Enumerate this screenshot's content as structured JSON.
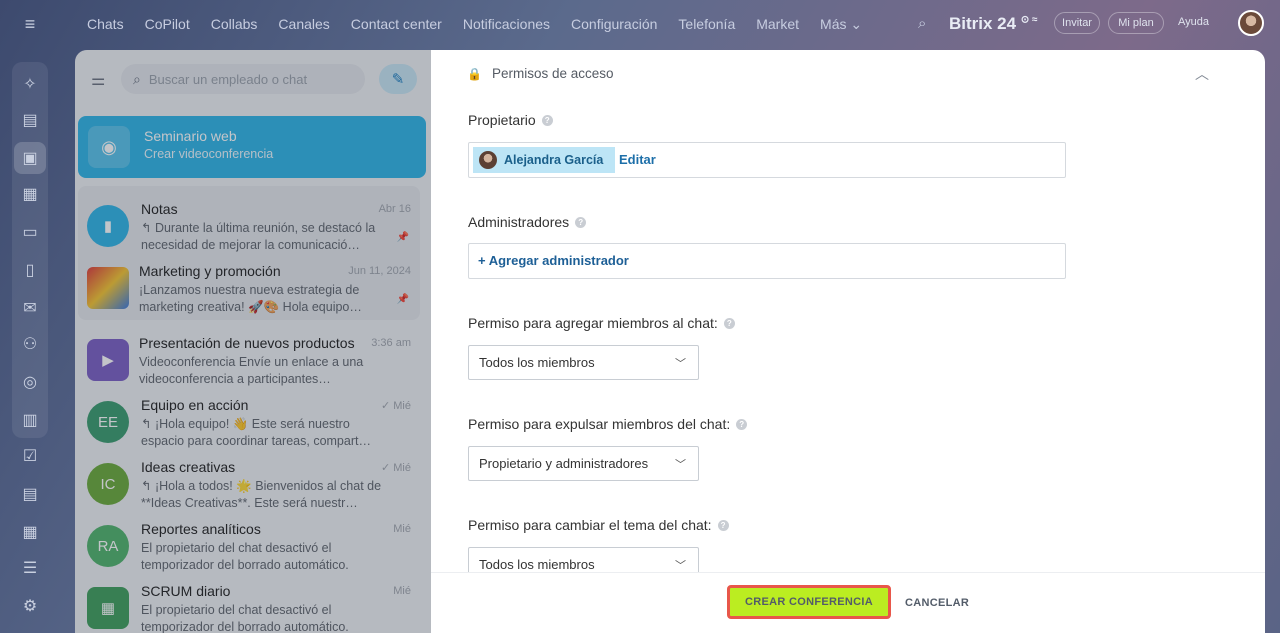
{
  "topnav": [
    "Chats",
    "CoPilot",
    "Collabs",
    "Canales",
    "Contact center",
    "Notificaciones",
    "Configuración",
    "Telefonía",
    "Market",
    "Más ⌄"
  ],
  "brand": {
    "name": "Bitrix 24",
    "mark": "⊙ ≈"
  },
  "header_buttons": {
    "invite": "Invitar",
    "plan": "Mi plan",
    "help": "Ayuda"
  },
  "search": {
    "placeholder": "Buscar un empleado o chat"
  },
  "webinar": {
    "title": "Seminario web",
    "subtitle": "Crear videoconferencia"
  },
  "chats": [
    {
      "name": "Notas",
      "date": "Abr 16",
      "msg": "↰ Durante la última reunión, se destacó la necesidad de mejorar la comunicació…",
      "pinned": true
    },
    {
      "name": "Marketing y promoción",
      "date": "Jun 11, 2024",
      "msg": "¡Lanzamos nuestra nueva estrategia de marketing creativa! 🚀🎨 Hola equipo…",
      "pinned": true,
      "muted": true
    },
    {
      "name": "Presentación de nuevos productos",
      "date": "3:36 am",
      "msg": "Videoconferencia Envíe un enlace a una videoconferencia a participantes…"
    },
    {
      "name": "Equipo en acción",
      "date": "✓ Mié",
      "initials": "EE",
      "msg": "↰ ¡Hola equipo! 👋 Este será nuestro espacio para coordinar tareas, compart…"
    },
    {
      "name": "Ideas creativas",
      "date": "✓ Mié",
      "initials": "IC",
      "msg": "↰ ¡Hola a todos! 🌟 Bienvenidos al chat de **Ideas Creativas**. Este será nuestr…"
    },
    {
      "name": "Reportes analíticos",
      "date": "Mié",
      "initials": "RA",
      "msg": "El propietario del chat desactivó el temporizador del borrado automático."
    },
    {
      "name": "SCRUM diario",
      "date": "Mié",
      "msg": "El propietario del chat desactivó el temporizador del borrado automático."
    }
  ],
  "settings": {
    "section_title": "Permisos de acceso",
    "owner_label": "Propietario",
    "owner_name": "Alejandra García",
    "edit_link": "Editar",
    "admins_label": "Administradores",
    "add_admin": "+ Agregar administrador",
    "add_members_label": "Permiso para agregar miembros al chat:",
    "add_members_value": "Todos los miembros",
    "kick_members_label": "Permiso para expulsar miembros del chat:",
    "kick_members_value": "Propietario y administradores",
    "change_topic_label": "Permiso para cambiar el tema del chat:",
    "change_topic_value": "Todos los miembros"
  },
  "footer": {
    "create": "CREAR CONFERENCIA",
    "cancel": "CANCELAR"
  },
  "colors": {
    "accent": "#2fb4e6",
    "create_btn": "#bbed21",
    "highlight_border": "#e8574a"
  }
}
